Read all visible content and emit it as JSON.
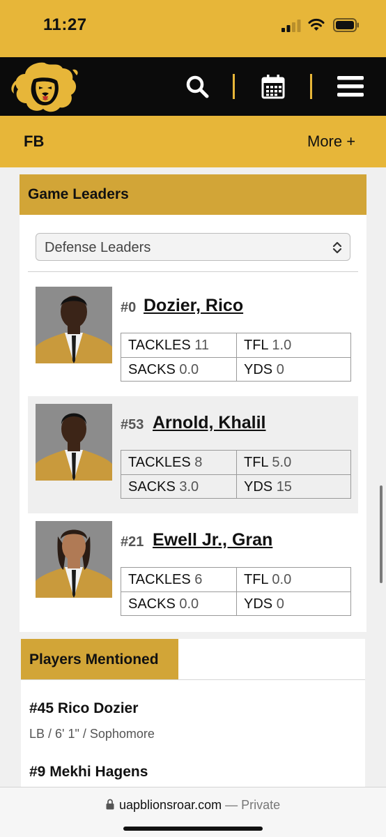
{
  "status": {
    "time": "11:27"
  },
  "header": {
    "logo": "lion-head-logo",
    "icons": [
      "search-icon",
      "calendar-icon",
      "hamburger-menu-icon"
    ]
  },
  "subnav": {
    "title": "FB",
    "more_label": "More +"
  },
  "game_leaders": {
    "title": "Game Leaders",
    "filter_value": "Defense Leaders",
    "leaders": [
      {
        "number": "#0",
        "name": "Dozier, Rico",
        "stats": [
          {
            "label": "TACKLES",
            "value": "11"
          },
          {
            "label": "TFL",
            "value": "1.0"
          },
          {
            "label": "SACKS",
            "value": "0.0"
          },
          {
            "label": "YDS",
            "value": "0"
          }
        ]
      },
      {
        "number": "#53",
        "name": "Arnold, Khalil",
        "stats": [
          {
            "label": "TACKLES",
            "value": "8"
          },
          {
            "label": "TFL",
            "value": "5.0"
          },
          {
            "label": "SACKS",
            "value": "3.0"
          },
          {
            "label": "YDS",
            "value": "15"
          }
        ]
      },
      {
        "number": "#21",
        "name": "Ewell Jr., Gran",
        "stats": [
          {
            "label": "TACKLES",
            "value": "6"
          },
          {
            "label": "TFL",
            "value": "0.0"
          },
          {
            "label": "SACKS",
            "value": "0.0"
          },
          {
            "label": "YDS",
            "value": "0"
          }
        ]
      }
    ]
  },
  "players_mentioned": {
    "title": "Players Mentioned",
    "players": [
      {
        "name": "#45 Rico Dozier",
        "meta": "LB / 6' 1\" / Sophomore"
      },
      {
        "name": "#9 Mekhi Hagens"
      }
    ]
  },
  "url_bar": {
    "domain": "uapblionsroar.com",
    "privacy": "— Private"
  },
  "colors": {
    "gold": "#e7b639",
    "header_gold": "#d2a537",
    "black": "#0b0b0b"
  }
}
